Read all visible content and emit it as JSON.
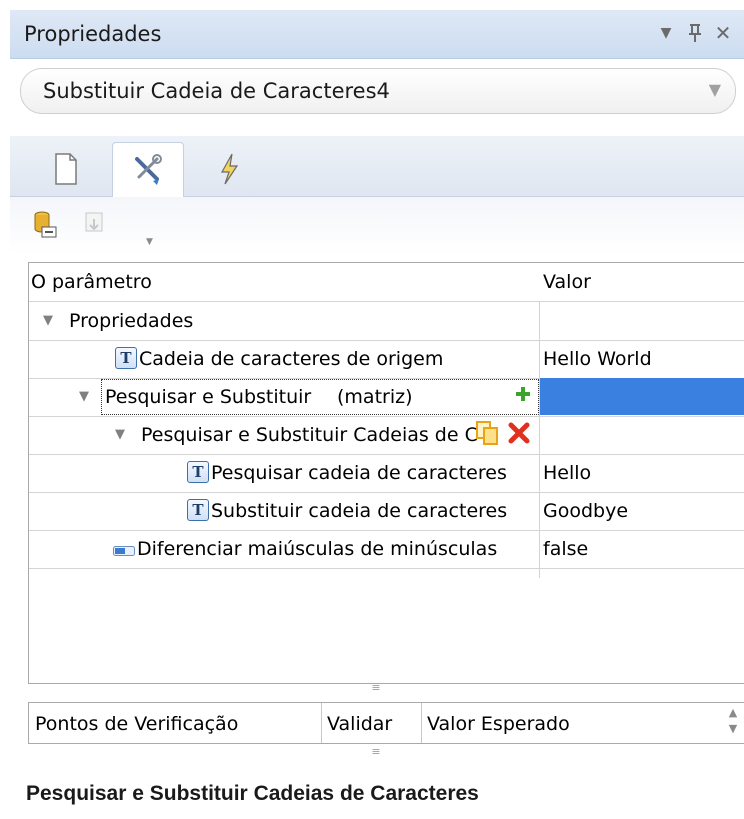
{
  "panel": {
    "title": "Propriedades",
    "controls": {
      "menu": "▼",
      "pin": "⊥",
      "close": "✕"
    }
  },
  "selector": {
    "value": "Substituir Cadeia de Caracteres4"
  },
  "tabs": [
    {
      "icon": "document-icon",
      "active": false
    },
    {
      "icon": "tools-icon",
      "active": true
    },
    {
      "icon": "lightning-icon",
      "active": false
    }
  ],
  "toolbar": [
    {
      "icon": "database-link-icon",
      "enabled": true
    },
    {
      "icon": "import-icon",
      "enabled": false
    }
  ],
  "property_table": {
    "columns": [
      "O parâmetro",
      "Valor"
    ],
    "rows": [
      {
        "label": "Propriedades",
        "value": "",
        "level": 0,
        "expanded": true,
        "icon": ""
      },
      {
        "label": "Cadeia de caracteres de origem",
        "value": "Hello World",
        "level": 1,
        "icon": "text-icon"
      },
      {
        "label": "Pesquisar e Substituir",
        "annotation": "(matriz)",
        "value": "",
        "level": 1,
        "expanded": true,
        "selected": true,
        "icon": ""
      },
      {
        "label": "Pesquisar e Substituir Cadeias de C",
        "value": "",
        "level": 2,
        "expanded": true,
        "icon": ""
      },
      {
        "label": "Pesquisar cadeia de caracteres",
        "value": "Hello",
        "level": 3,
        "icon": "text-icon"
      },
      {
        "label": "Substituir cadeia de caracteres",
        "value": "Goodbye",
        "level": 3,
        "icon": "text-icon"
      },
      {
        "label": "Diferenciar maiúsculas de minúsculas",
        "value": "false",
        "level": 1,
        "icon": "boolean-icon"
      }
    ]
  },
  "checkpoints": {
    "columns": [
      "Pontos de Verificação",
      "Validar",
      "Valor Esperado"
    ]
  },
  "description": {
    "title": "Pesquisar e Substituir Cadeias de Caracteres"
  },
  "colors": {
    "header_bg": "#d5e2f3",
    "selection": "#3a80e0",
    "add": "#3aa52a",
    "delete": "#e0301e",
    "copy": "#e8a317"
  }
}
